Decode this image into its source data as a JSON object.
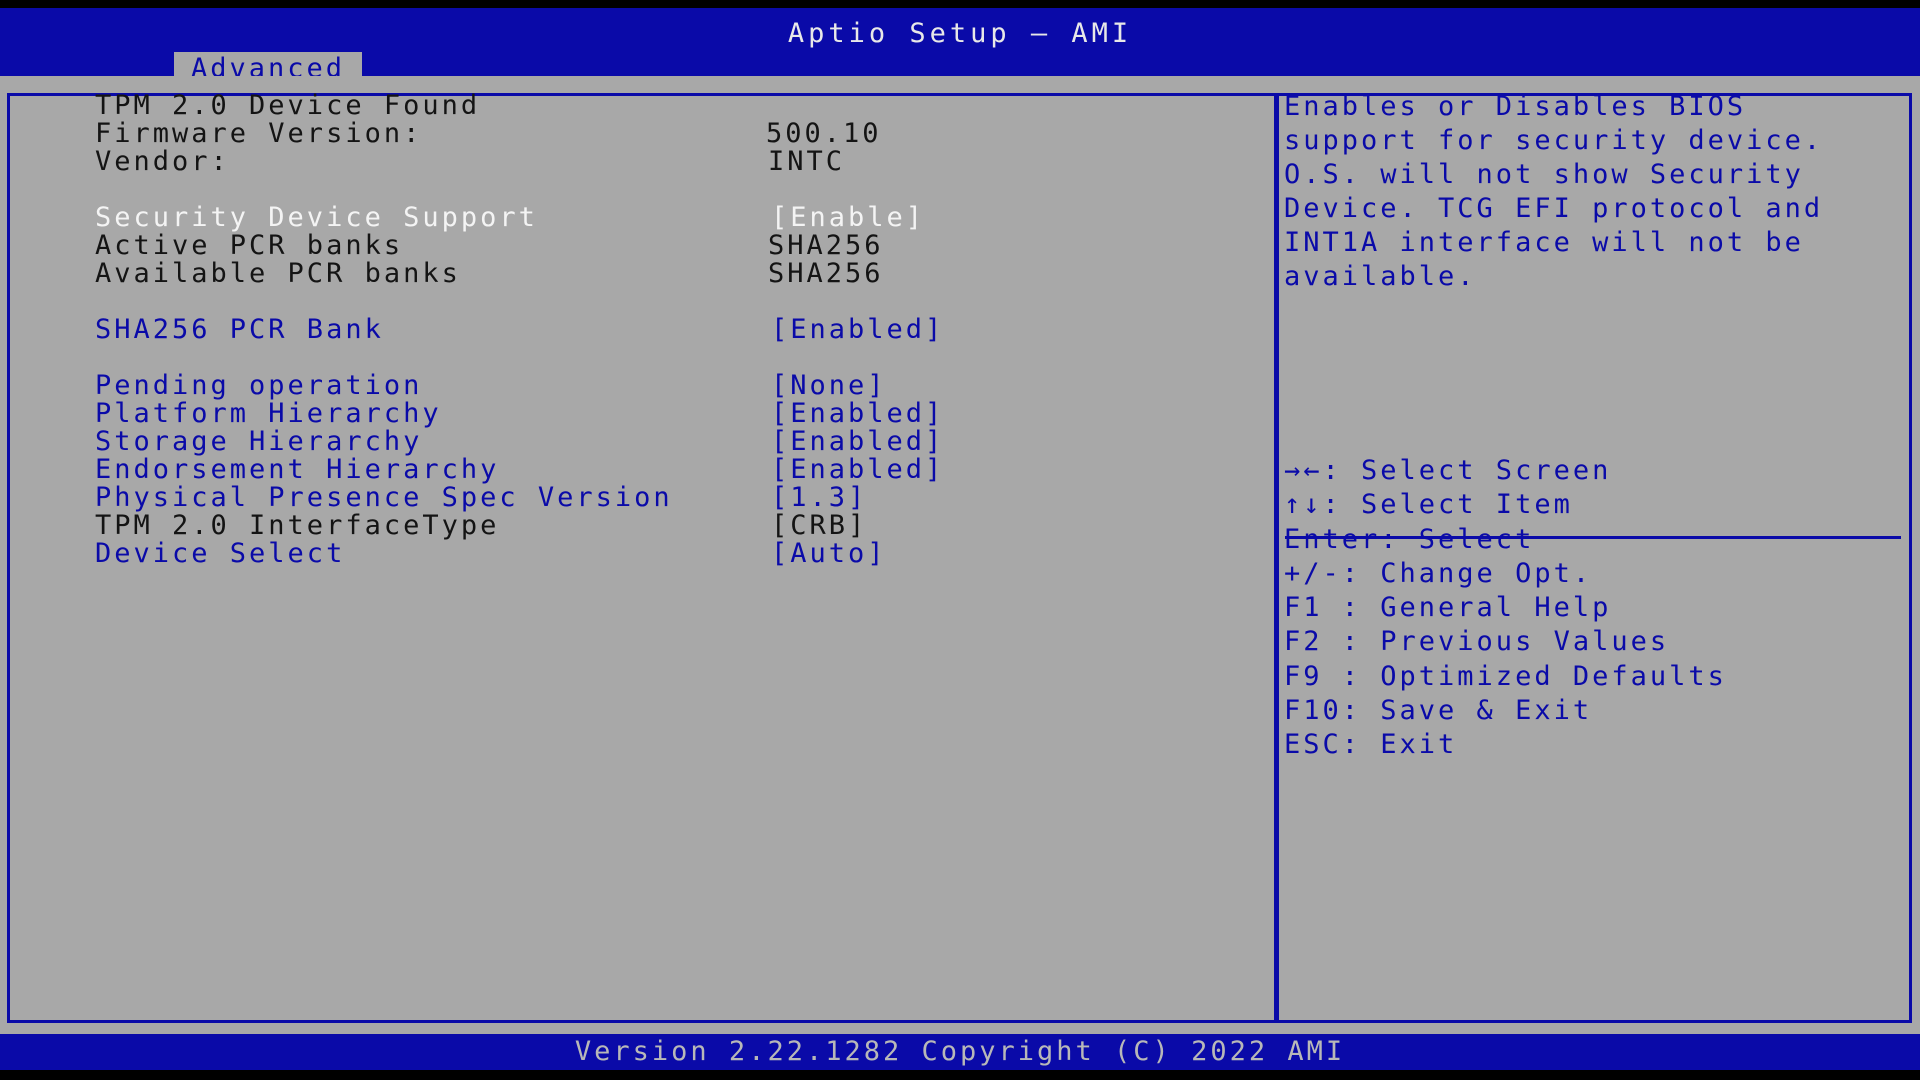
{
  "header": {
    "title": "Aptio Setup – AMI",
    "tabs": [
      "Advanced"
    ]
  },
  "info": {
    "heading": "TPM 2.0 Device Found",
    "firmware_label": "Firmware Version:",
    "firmware_value": "500.10",
    "vendor_label": "Vendor:",
    "vendor_value": "INTC"
  },
  "settings": [
    {
      "label": "Security Device Support",
      "value": "[Enable]"
    },
    {
      "label": "Active PCR banks",
      "value": "SHA256"
    },
    {
      "label": "Available PCR banks",
      "value": "SHA256"
    },
    {
      "label": "SHA256 PCR Bank",
      "value": "[Enabled]"
    },
    {
      "label": "Pending operation",
      "value": "[None]"
    },
    {
      "label": "Platform Hierarchy",
      "value": "[Enabled]"
    },
    {
      "label": "Storage Hierarchy",
      "value": "[Enabled]"
    },
    {
      "label": "Endorsement Hierarchy",
      "value": "[Enabled]"
    },
    {
      "label": "Physical Presence Spec Version",
      "value": "[1.3]"
    },
    {
      "label": "TPM 2.0 InterfaceType",
      "value": "[CRB]"
    },
    {
      "label": "Device Select",
      "value": "[Auto]"
    }
  ],
  "help": {
    "text": "Enables or Disables BIOS\nsupport for security device.\nO.S. will not show Security\nDevice. TCG EFI protocol and\nINT1A interface will not be\navailable."
  },
  "keys": [
    "→←: Select Screen",
    "↑↓: Select Item",
    "Enter: Select",
    "+/-: Change Opt.",
    "F1 : General Help",
    "F2 : Previous Values",
    "F9 : Optimized Defaults",
    "F10: Save & Exit",
    "ESC: Exit"
  ],
  "footer": {
    "version": "Version 2.22.1282 Copyright (C) 2022 AMI"
  },
  "colors": {
    "bios_blue": "#0a0aa8",
    "panel_gray": "#a8a8a8",
    "highlight_white": "#f4f4f4"
  }
}
